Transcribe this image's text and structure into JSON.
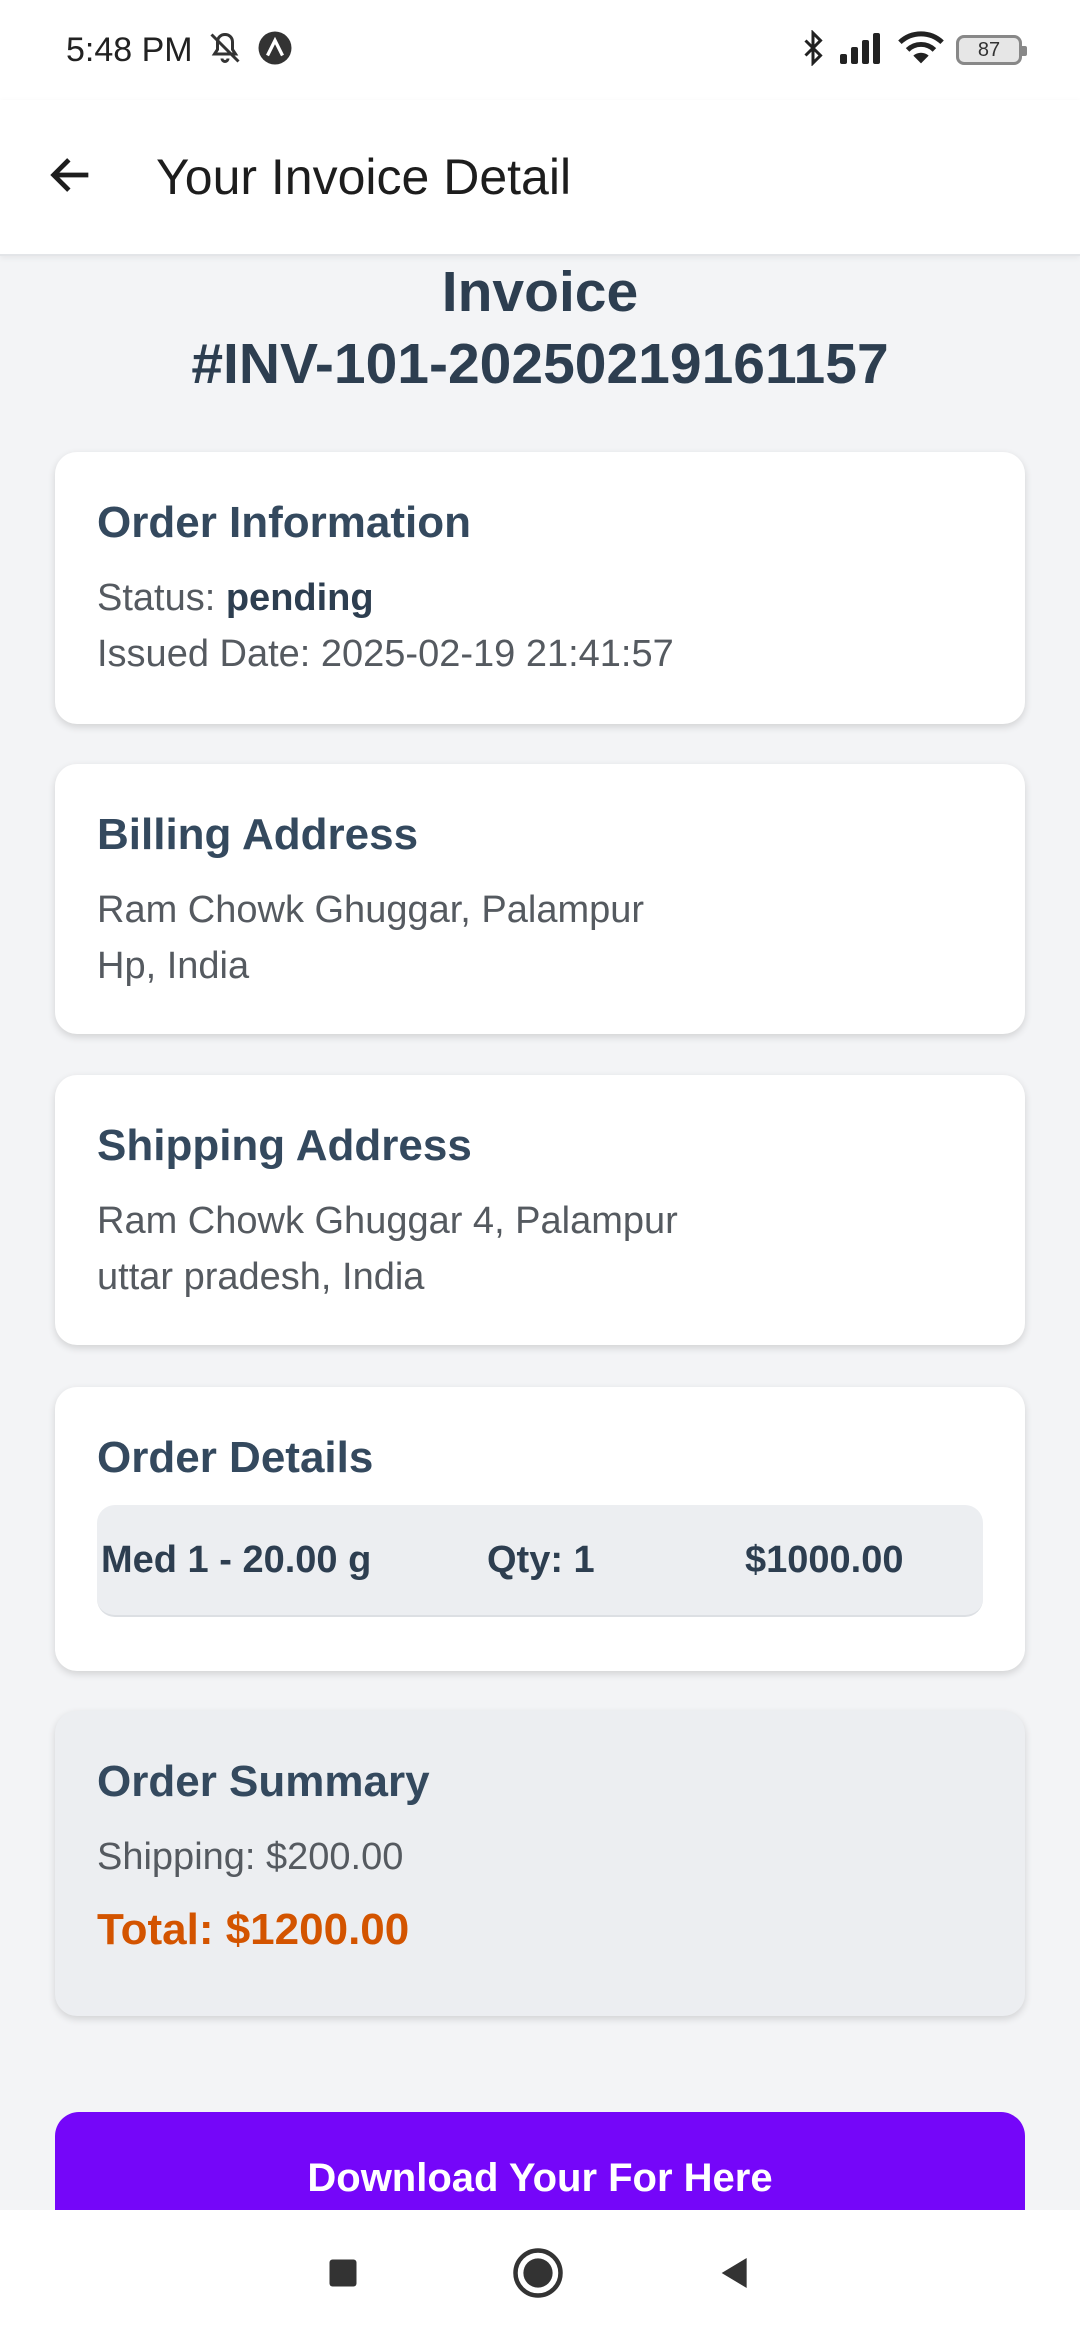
{
  "status_bar": {
    "time": "5:48 PM",
    "battery": "87",
    "icons": [
      "mute-bell-icon",
      "app-notification-icon",
      "bluetooth-icon",
      "signal-icon",
      "wifi-icon",
      "battery-icon"
    ]
  },
  "app_bar": {
    "title": "Your Invoice Detail",
    "back_icon": "arrow-left-icon"
  },
  "invoice": {
    "heading_line1": "Invoice",
    "heading_line2": "#INV-101-20250219161157"
  },
  "order_information": {
    "title": "Order Information",
    "status_label": "Status: ",
    "status_value": "pending",
    "issued_date": "Issued Date: 2025-02-19 21:41:57"
  },
  "billing_address": {
    "title": "Billing Address",
    "line1": "Ram Chowk Ghuggar, Palampur",
    "line2": "Hp, India"
  },
  "shipping_address": {
    "title": "Shipping Address",
    "line1": "Ram Chowk Ghuggar 4, Palampur",
    "line2": "uttar pradesh, India"
  },
  "order_details": {
    "title": "Order Details",
    "items": [
      {
        "name": "Med 1 - 20.00 g",
        "qty": "Qty: 1",
        "price": "$1000.00"
      }
    ]
  },
  "order_summary": {
    "title": "Order Summary",
    "shipping": "Shipping: $200.00",
    "total": "Total: $1200.00"
  },
  "download_button": {
    "label": "Download Your For Here"
  },
  "colors": {
    "accent_purple": "#7506f9",
    "total_orange": "#d35400",
    "heading_navy": "#2d3e50"
  },
  "nav_bar": {
    "icons": [
      "recents-square-icon",
      "home-circle-icon",
      "back-triangle-icon"
    ]
  }
}
